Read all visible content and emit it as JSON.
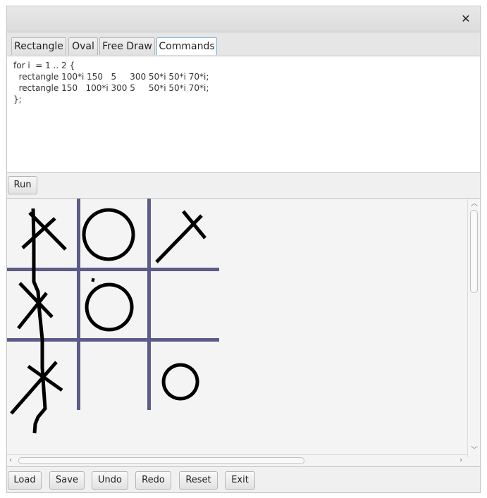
{
  "window": {
    "close_glyph": "✕"
  },
  "tabs": [
    {
      "label": "Rectangle",
      "selected": false
    },
    {
      "label": "Oval",
      "selected": false
    },
    {
      "label": "Free Draw",
      "selected": false
    },
    {
      "label": "Commands",
      "selected": true
    }
  ],
  "editor": {
    "lines": [
      "for i  = 1 .. 2 {",
      "  rectangle 100*i 150   5     300 50*i 50*i 70*i;",
      "  rectangle 150   100*i 300 5     50*i 50*i 70*i;",
      "};"
    ]
  },
  "run_button": "Run",
  "canvas": {
    "grid_color": "#5c5c8a",
    "stroke_color": "#000000"
  },
  "bottom_buttons": [
    "Load",
    "Save",
    "Undo",
    "Redo",
    "Reset",
    "Exit"
  ]
}
